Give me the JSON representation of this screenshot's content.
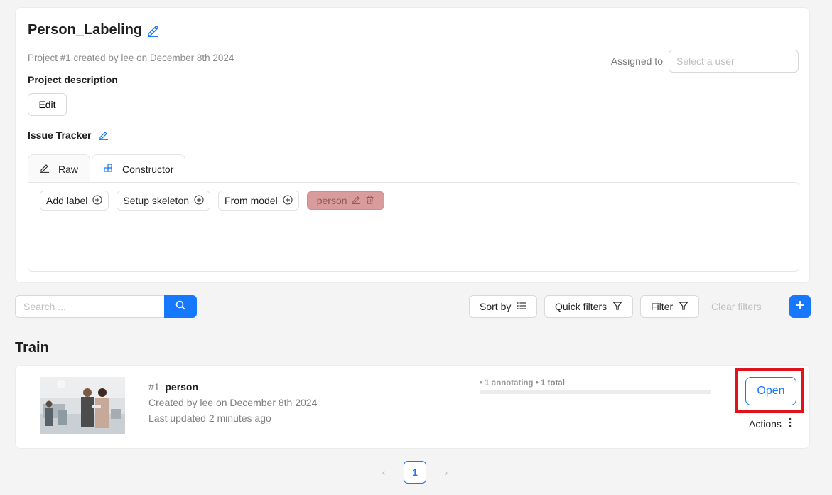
{
  "project": {
    "title": "Person_Labeling",
    "meta": "Project #1 created by lee on December 8th 2024",
    "assigned_label": "Assigned to",
    "assigned_placeholder": "Select a user",
    "description_label": "Project description",
    "edit_label": "Edit",
    "issue_tracker_label": "Issue Tracker"
  },
  "tabs": [
    {
      "label": "Raw",
      "icon": "pencil-icon",
      "active": false
    },
    {
      "label": "Constructor",
      "icon": "constructor-icon",
      "active": true
    }
  ],
  "constructor": {
    "add_label": "Add label",
    "setup_skeleton": "Setup skeleton",
    "from_model": "From model",
    "labels": [
      {
        "name": "person",
        "color": "#d99b9b"
      }
    ]
  },
  "toolbar": {
    "search_placeholder": "Search ...",
    "sort_by": "Sort by",
    "quick_filters": "Quick filters",
    "filter": "Filter",
    "clear_filters": "Clear filters"
  },
  "section_title": "Train",
  "task": {
    "id": "#1:",
    "name": "person",
    "created": "Created by lee on December 8th 2024",
    "updated": "Last updated 2 minutes ago",
    "annotating": "• 1 annotating",
    "total": "• 1 total",
    "progress": 0,
    "open_label": "Open",
    "actions_label": "Actions"
  },
  "pagination": {
    "current_page": "1"
  },
  "colors": {
    "accent": "#1677ff",
    "highlight": "#e0121b",
    "background": "#f4f4f4"
  }
}
